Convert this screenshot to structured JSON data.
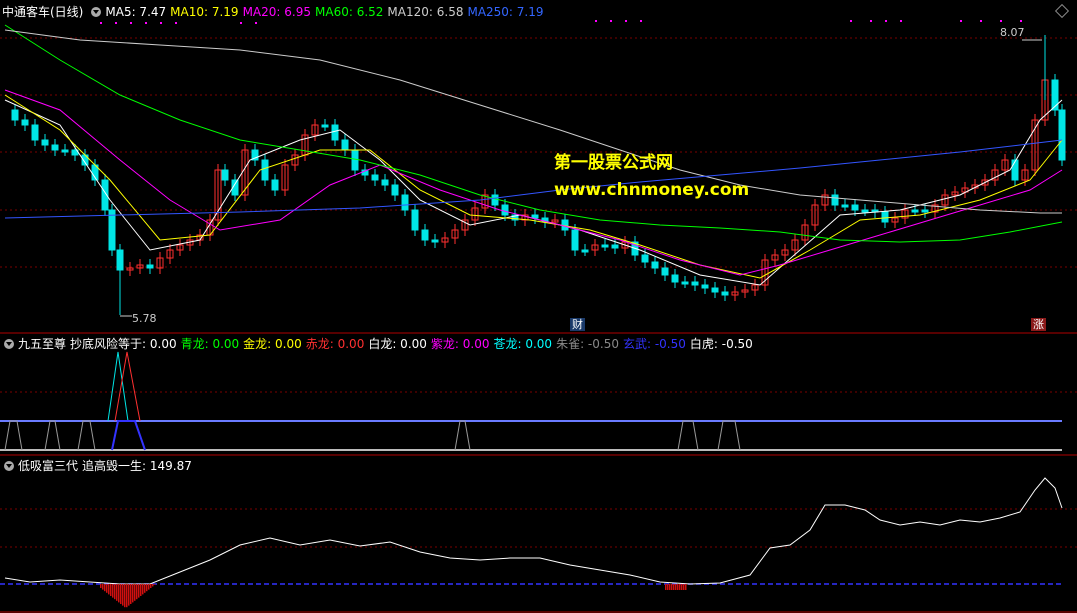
{
  "main_panel": {
    "title": "中通客车(日线)",
    "ma": [
      {
        "label": "MA5: 7.47",
        "color": "#ffffff"
      },
      {
        "label": "MA10: 7.19",
        "color": "#ffff00"
      },
      {
        "label": "MA20: 6.95",
        "color": "#ff00ff"
      },
      {
        "label": "MA60: 6.52",
        "color": "#00ff00"
      },
      {
        "label": "MA120: 6.58",
        "color": "#cccccc"
      },
      {
        "label": "MA250: 7.19",
        "color": "#3366ff"
      }
    ],
    "high_label": "8.07",
    "low_label": "5.78",
    "tag_cai": "财",
    "tag_zhang": "涨",
    "watermark_line1": "第一股票公式网",
    "watermark_line2": "www.chnmoney.com"
  },
  "panel2": {
    "title": "九五至尊",
    "items": [
      {
        "label": "抄底风险等于: 0.00",
        "color": "#ffffff"
      },
      {
        "label": "青龙: 0.00",
        "color": "#00ff00"
      },
      {
        "label": "金龙: 0.00",
        "color": "#ffff00"
      },
      {
        "label": "赤龙: 0.00",
        "color": "#ff3030"
      },
      {
        "label": "白龙: 0.00",
        "color": "#ffffff"
      },
      {
        "label": "紫龙: 0.00",
        "color": "#ff00ff"
      },
      {
        "label": "苍龙: 0.00",
        "color": "#00ffff"
      },
      {
        "label": "朱雀: -0.50",
        "color": "#888888"
      },
      {
        "label": "玄武: -0.50",
        "color": "#3333ff"
      },
      {
        "label": "白虎: -0.50",
        "color": "#ffffff"
      }
    ]
  },
  "panel3": {
    "title": "低吸富三代",
    "items": [
      {
        "label": "追高毁一生: 149.87",
        "color": "#ffffff"
      }
    ]
  },
  "colors": {
    "up": "#ff3030",
    "down": "#00e5e5",
    "grid": "#7a0000",
    "divider": "#b00000"
  }
}
